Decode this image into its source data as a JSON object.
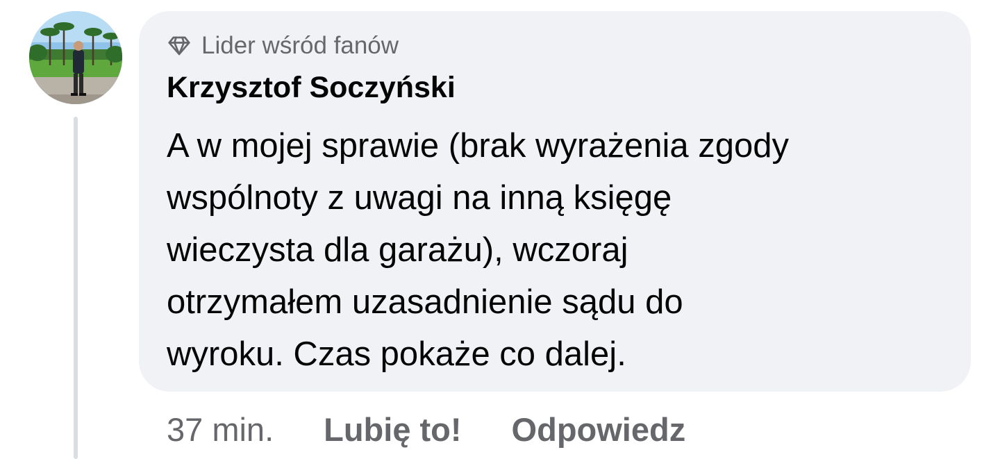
{
  "comment": {
    "avatar_icon": "user-avatar-photo",
    "badge": {
      "icon": "diamond-icon",
      "label": "Lider wśród fanów"
    },
    "author": "Krzysztof Soczyński",
    "text_lines": [
      "A w mojej sprawie (brak wyrażenia zgody",
      "wspólnoty z uwagi na inną księgę",
      "wieczysta dla garażu), wczoraj",
      "otrzymałem uzasadnienie sądu do",
      "wyroku. Czas pokaże co dalej."
    ],
    "time": "37 min.",
    "like_label": "Lubię to!",
    "reply_label": "Odpowiedz"
  },
  "colors": {
    "bubble_bg": "#f0f2f5",
    "text": "#050505",
    "secondary_text": "#65676b",
    "thread_line": "#dadde1"
  }
}
